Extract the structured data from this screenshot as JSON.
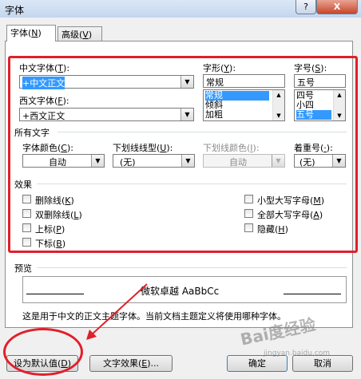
{
  "window": {
    "title": "字体",
    "help_label": "?",
    "close_label": "X"
  },
  "tabs": [
    {
      "label": "字体",
      "key": "N"
    },
    {
      "label": "高级",
      "key": "V"
    }
  ],
  "chinese_font": {
    "label": "中文字体",
    "key": "T",
    "value": "+中文正文"
  },
  "western_font": {
    "label": "西文字体",
    "key": "F",
    "value": "+西文正文"
  },
  "style": {
    "label": "字形",
    "key": "Y",
    "value": "常规",
    "options": [
      "常规",
      "倾斜",
      "加粗"
    ],
    "selected": "常规"
  },
  "size": {
    "label": "字号",
    "key": "S",
    "value": "五号",
    "options": [
      "四号",
      "小四",
      "五号"
    ],
    "selected": "五号"
  },
  "all_text": {
    "heading": "所有文字",
    "font_color": {
      "label": "字体颜色",
      "key": "C",
      "value": "自动"
    },
    "underline_type": {
      "label": "下划线线型",
      "key": "U",
      "value": "(无)"
    },
    "underline_color": {
      "label": "下划线颜色",
      "key": "I",
      "value": "自动"
    },
    "emphasis": {
      "label": "着重号",
      "key": "·",
      "value": "(无)"
    }
  },
  "effects": {
    "heading": "效果",
    "left": [
      {
        "label": "删除线",
        "key": "K"
      },
      {
        "label": "双删除线",
        "key": "L"
      },
      {
        "label": "上标",
        "key": "P"
      },
      {
        "label": "下标",
        "key": "B"
      }
    ],
    "right": [
      {
        "label": "小型大写字母",
        "key": "M"
      },
      {
        "label": "全部大写字母",
        "key": "A"
      },
      {
        "label": "隐藏",
        "key": "H"
      }
    ]
  },
  "preview": {
    "heading": "预览",
    "sample": "微软卓越  AaBbCc",
    "description": "这是用于中文的正文主题字体。当前文档主题定义将使用哪种字体。"
  },
  "buttons": {
    "set_default": {
      "label": "设为默认值",
      "key": "D"
    },
    "text_effects": {
      "label": "文字效果",
      "key": "E",
      "suffix": "..."
    },
    "ok": "确定",
    "cancel": "取消"
  },
  "watermark": {
    "main": "Bai度经验",
    "sub": "jingyan.baidu.com"
  },
  "colors": {
    "annotation_red": "#e0202a",
    "selection_blue": "#3399ff"
  }
}
